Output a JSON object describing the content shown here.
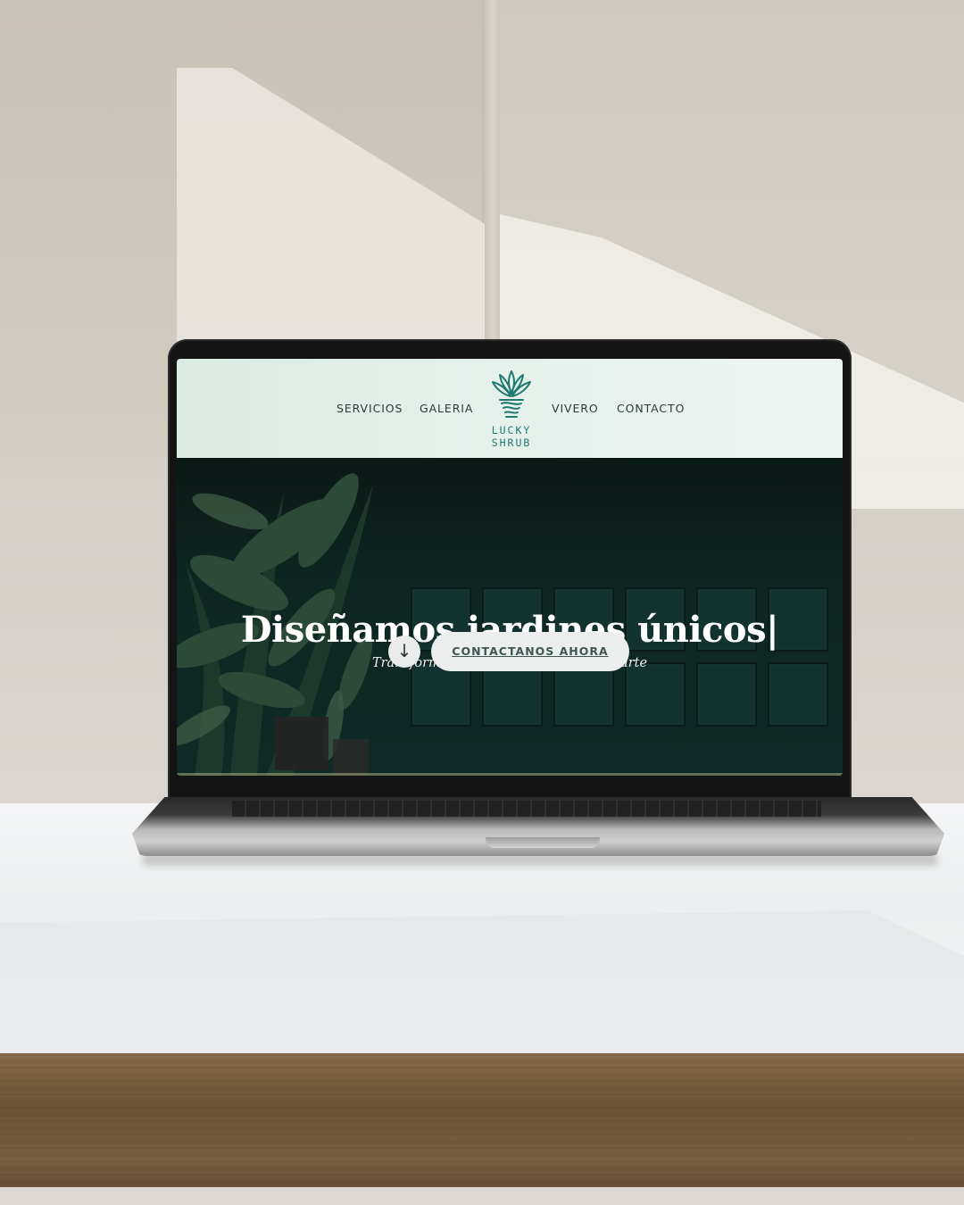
{
  "nav": {
    "left": [
      "SERVICIOS",
      "GALERIA"
    ],
    "right": [
      "VIVERO",
      "CONTACTO"
    ]
  },
  "logo": {
    "line1": "LUCKY",
    "line2": "SHRUB",
    "icon": "plant-pot-icon"
  },
  "hero": {
    "title": "Diseñamos jardines únicos|",
    "subtitle": "Transformamos espacios en obras de arte",
    "scroll_icon": "↓",
    "cta_label": "CONTACTANOS AHORA"
  },
  "colors": {
    "header_bg": "#e4f0eb",
    "hero_bg": "#0d2622",
    "brand": "#1f7a70",
    "button_bg": "#eceeed",
    "button_text": "#3e5552"
  }
}
